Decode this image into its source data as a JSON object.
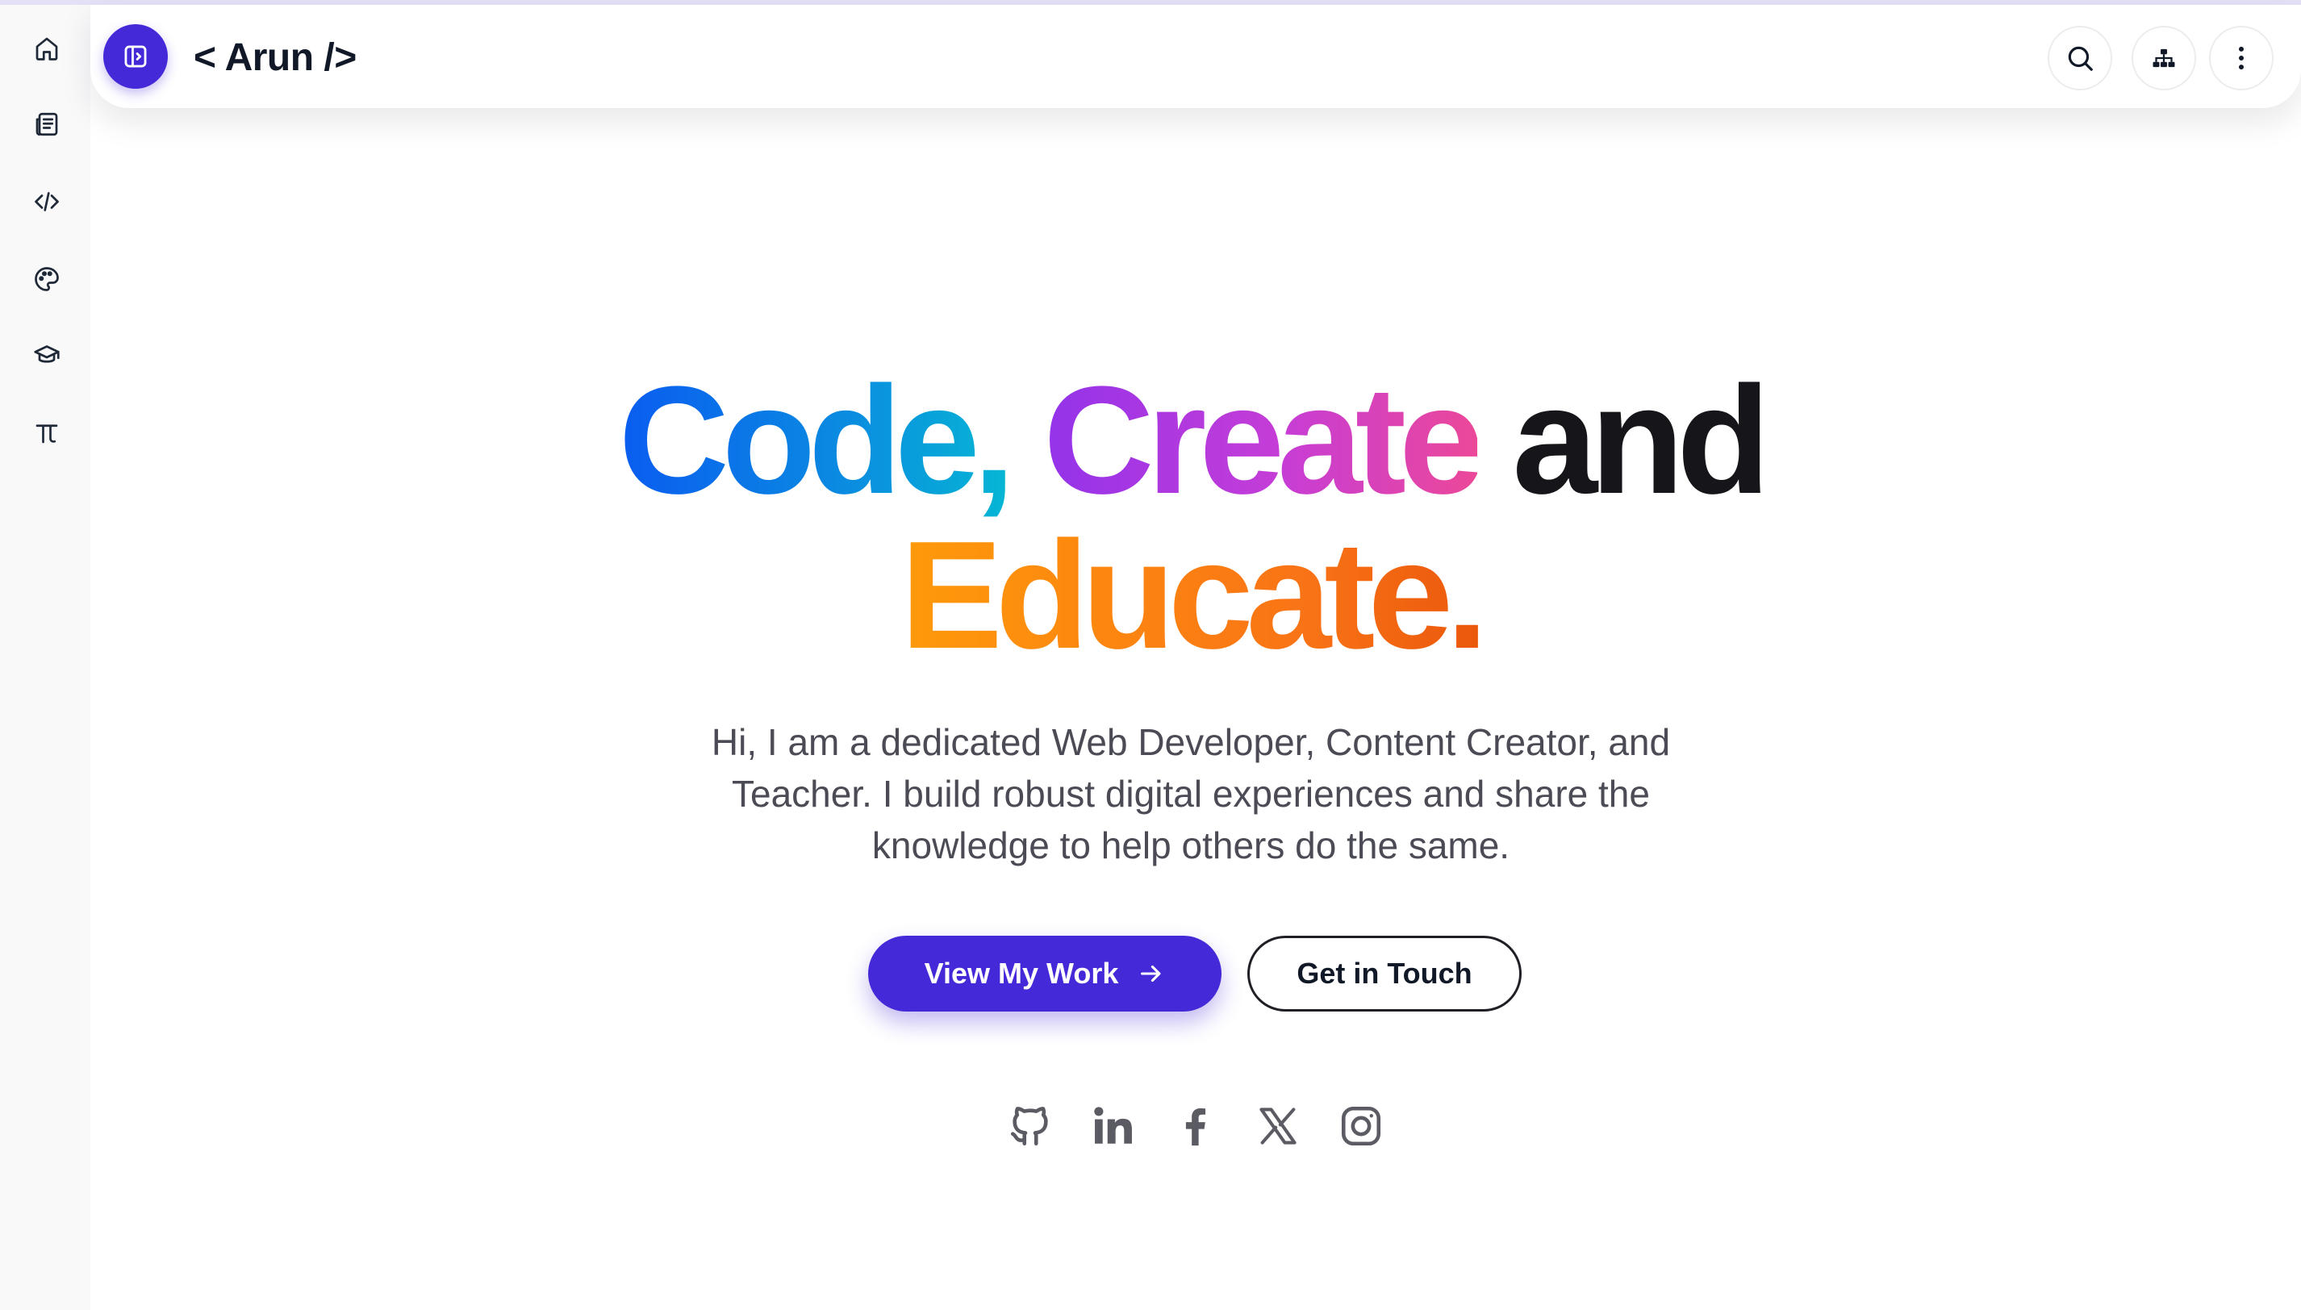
{
  "header": {
    "brand": "< Arun />"
  },
  "hero": {
    "title_code": "Code,",
    "title_create": "Create",
    "title_and": "and",
    "title_educate": "Educate.",
    "description": "Hi, I am a dedicated Web Developer, Content Creator, and Teacher. I build robust digital experiences and share the knowledge to help others do the same.",
    "primary_cta": "View My Work",
    "secondary_cta": "Get in Touch"
  },
  "colors": {
    "accent": "#4429d8",
    "gradient_code": [
      "#0a5cf0",
      "#06b6d4"
    ],
    "gradient_create": [
      "#9333ea",
      "#ec4899"
    ],
    "gradient_educate": [
      "#ff9a0a",
      "#ea580c"
    ]
  },
  "icons": {
    "rail": [
      "home-icon",
      "newspaper-icon",
      "code-icon",
      "palette-icon",
      "graduation-cap-icon",
      "pi-icon"
    ],
    "header": [
      "sidebar-toggle-icon",
      "search-icon",
      "sitemap-icon",
      "more-vertical-icon"
    ],
    "social": [
      "github-icon",
      "linkedin-icon",
      "facebook-icon",
      "x-icon",
      "instagram-icon"
    ]
  }
}
